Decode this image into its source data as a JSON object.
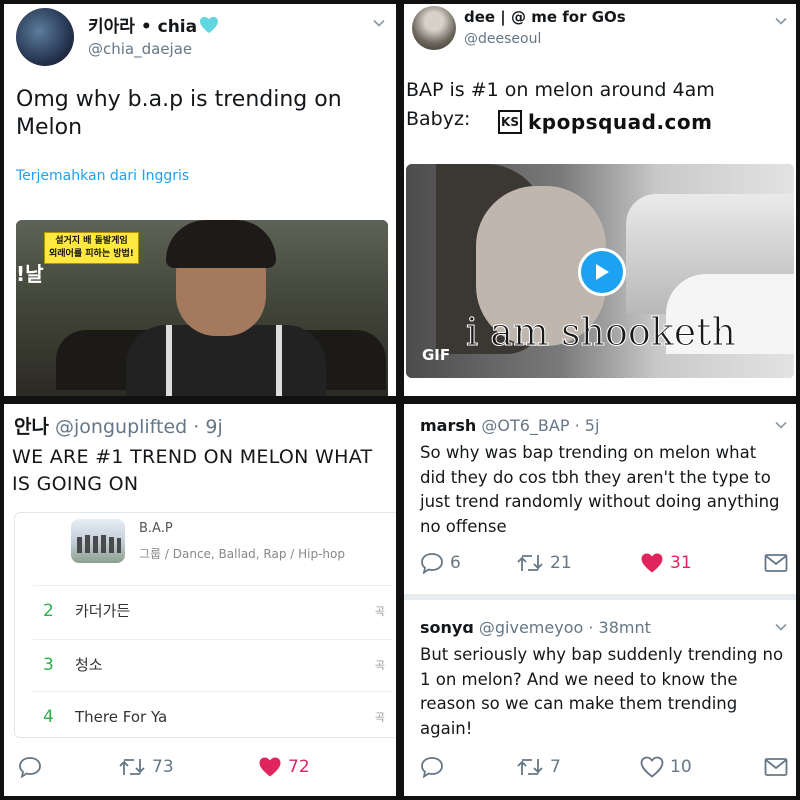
{
  "tweet1": {
    "name": "키아라 • chia",
    "heart": "💙",
    "handle": "@chia_daejae",
    "text": "Omg why b.a.p is trending on Melon",
    "translate": "Terjemahkan dari Inggris",
    "image_caption_line1": "설거지 배 돌발게임",
    "image_caption_line2": "외래어를 피하는 방법!",
    "image_side_text": "!날"
  },
  "tweet2": {
    "name": "dee | @ me for GOs",
    "handle": "@deeseoul",
    "text_line1": "BAP is #1 on melon around 4am",
    "text_line2": "Babyz:",
    "watermark_logo": "KS",
    "watermark": "kpopsquad.com",
    "gif_label": "GIF",
    "gif_caption": "i am shooketh"
  },
  "tweet3": {
    "name": "안나",
    "handle": "@jonguplifted",
    "time": "· 9j",
    "text": "WE ARE #1 TREND ON MELON WHAT IS GOING ON",
    "card": {
      "artist": "B.A.P",
      "genre": "그룹 / Dance, Ballad, Rap / Hip-hop",
      "songs": [
        {
          "num": "2",
          "title": "카더가든",
          "tag": "곡"
        },
        {
          "num": "3",
          "title": "청소",
          "tag": "곡"
        },
        {
          "num": "4",
          "title": "There For Ya",
          "tag": "곡"
        }
      ]
    },
    "retweets": "73",
    "likes": "72"
  },
  "tweet4": {
    "name": "marsh",
    "handle": "@OT6_BAP",
    "time": "· 5j",
    "text": "So why was bap trending on melon what did they do cos tbh they aren't the type to just trend randomly without doing anything no offense",
    "replies": "6",
    "retweets": "21",
    "likes": "31"
  },
  "tweet5": {
    "name": "sonyɑ",
    "handle": "@givemeyoo",
    "time": "· 38mnt",
    "text": "But seriously why bap suddenly trending no 1 on melon? And we need to know the reason so we can make them trending again!",
    "retweets": "7",
    "likes": "10"
  },
  "colors": {
    "accent": "#1da1f2",
    "like": "#e0245e",
    "muted": "#657786",
    "melon_green": "#2cb24a"
  }
}
